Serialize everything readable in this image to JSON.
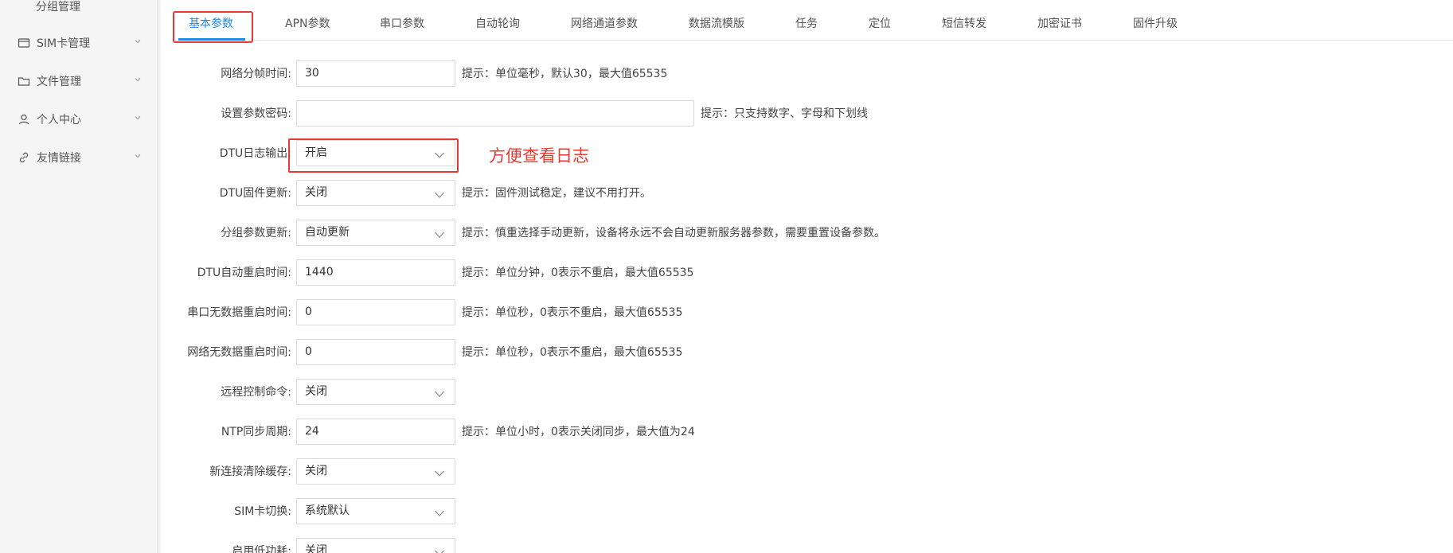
{
  "sidebar": {
    "sub_item": "分组管理",
    "items": [
      {
        "label": "SIM卡管理",
        "icon": "sim-card-icon"
      },
      {
        "label": "文件管理",
        "icon": "folder-icon"
      },
      {
        "label": "个人中心",
        "icon": "user-icon"
      },
      {
        "label": "友情链接",
        "icon": "link-icon"
      }
    ]
  },
  "tabs": [
    {
      "label": "基本参数",
      "active": true
    },
    {
      "label": "APN参数"
    },
    {
      "label": "串口参数"
    },
    {
      "label": "自动轮询"
    },
    {
      "label": "网络通道参数"
    },
    {
      "label": "数据流模版"
    },
    {
      "label": "任务"
    },
    {
      "label": "定位"
    },
    {
      "label": "短信转发"
    },
    {
      "label": "加密证书"
    },
    {
      "label": "固件升级"
    }
  ],
  "form": {
    "frame_time": {
      "label": "网络分帧时间:",
      "value": "30",
      "hint": "提示：单位毫秒，默认30，最大值65535"
    },
    "param_password": {
      "label": "设置参数密码:",
      "value": "",
      "hint": "提示：只支持数字、字母和下划线"
    },
    "dtu_log": {
      "label": "DTU日志输出:",
      "value": "开启"
    },
    "dtu_firmware": {
      "label": "DTU固件更新:",
      "value": "关闭",
      "hint": "提示：固件测试稳定，建议不用打开。"
    },
    "group_update": {
      "label": "分组参数更新:",
      "value": "自动更新",
      "hint": "提示：慎重选择手动更新，设备将永远不会自动更新服务器参数，需要重置设备参数。"
    },
    "auto_restart": {
      "label": "DTU自动重启时间:",
      "value": "1440",
      "hint": "提示：单位分钟，0表示不重启，最大值65535"
    },
    "serial_idle_restart": {
      "label": "串口无数据重启时间:",
      "value": "0",
      "hint": "提示：单位秒，0表示不重启，最大值65535"
    },
    "net_idle_restart": {
      "label": "网络无数据重启时间:",
      "value": "0",
      "hint": "提示：单位秒，0表示不重启，最大值65535"
    },
    "remote_control": {
      "label": "远程控制命令:",
      "value": "关闭"
    },
    "ntp_period": {
      "label": "NTP同步周期:",
      "value": "24",
      "hint": "提示：单位小时，0表示关闭同步，最大值为24"
    },
    "new_conn_clear": {
      "label": "新连接清除缓存:",
      "value": "关闭"
    },
    "sim_switch": {
      "label": "SIM卡切换:",
      "value": "系统默认"
    },
    "low_power": {
      "label": "启用低功耗:",
      "value": "关闭"
    }
  },
  "annotation": {
    "text": "方便查看日志",
    "color": "#e53935"
  },
  "colors": {
    "accent": "#1e88e5",
    "highlight": "#e53935"
  }
}
